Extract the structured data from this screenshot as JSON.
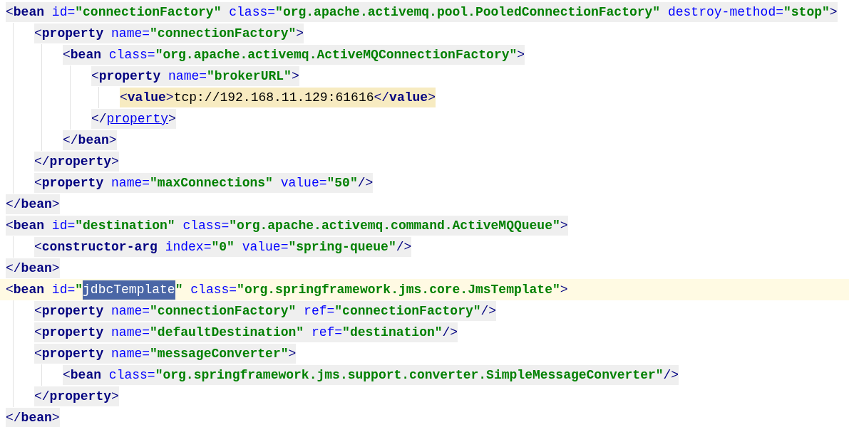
{
  "lines": [
    {
      "shaded": true,
      "matched": false,
      "current": false,
      "tokens": [
        {
          "kind": "open",
          "text": "<"
        },
        {
          "kind": "tag",
          "text": "bean"
        },
        {
          "kind": "attr",
          "text": "id="
        },
        {
          "kind": "value",
          "text": "\"connectionFactory\""
        },
        {
          "kind": "attr",
          "text": "class="
        },
        {
          "kind": "value",
          "text": "\"org.apache.activemq.pool.PooledConnectionFactory\""
        },
        {
          "kind": "attr",
          "text": "destroy-method="
        },
        {
          "kind": "value",
          "text": "\"stop\""
        },
        {
          "kind": "close",
          "text": ">"
        }
      ],
      "children": [
        {
          "shaded": true,
          "matched": false,
          "current": false,
          "tokens": [
            {
              "kind": "open",
              "text": "<"
            },
            {
              "kind": "tag",
              "text": "property"
            },
            {
              "kind": "attr",
              "text": "name="
            },
            {
              "kind": "value",
              "text": "\"connectionFactory\""
            },
            {
              "kind": "close",
              "text": ">"
            }
          ],
          "children": [
            {
              "shaded": true,
              "matched": false,
              "current": false,
              "tokens": [
                {
                  "kind": "open",
                  "text": "<"
                },
                {
                  "kind": "tag",
                  "text": "bean"
                },
                {
                  "kind": "attr",
                  "text": "class="
                },
                {
                  "kind": "value",
                  "text": "\"org.apache.activemq.ActiveMQConnectionFactory\""
                },
                {
                  "kind": "close",
                  "text": ">"
                }
              ],
              "children": [
                {
                  "shaded": true,
                  "matched": false,
                  "current": false,
                  "tokens": [
                    {
                      "kind": "open",
                      "text": "<"
                    },
                    {
                      "kind": "tag",
                      "text": "property"
                    },
                    {
                      "kind": "attr",
                      "text": "name="
                    },
                    {
                      "kind": "value",
                      "text": "\"brokerURL\""
                    },
                    {
                      "kind": "close",
                      "text": ">"
                    }
                  ],
                  "children": [
                    {
                      "matched": true,
                      "current": false,
                      "tokens": [
                        {
                          "kind": "open",
                          "text": "<"
                        },
                        {
                          "kind": "tag",
                          "text": "value"
                        },
                        {
                          "kind": "close",
                          "text": ">"
                        },
                        {
                          "kind": "text",
                          "text": "tcp://192.168.11.129:61616"
                        },
                        {
                          "kind": "open",
                          "text": "</"
                        },
                        {
                          "kind": "tag",
                          "text": "value"
                        },
                        {
                          "kind": "close",
                          "text": ">"
                        }
                      ]
                    }
                  ]
                },
                {
                  "shaded": true,
                  "matched": false,
                  "current": false,
                  "tokens": [
                    {
                      "kind": "open",
                      "text": "</"
                    },
                    {
                      "kind": "tag",
                      "text": "property",
                      "underlined": true
                    },
                    {
                      "kind": "close",
                      "text": ">"
                    }
                  ]
                }
              ]
            },
            {
              "shaded": true,
              "matched": false,
              "current": false,
              "tokens": [
                {
                  "kind": "open",
                  "text": "</"
                },
                {
                  "kind": "tag",
                  "text": "bean"
                },
                {
                  "kind": "close",
                  "text": ">"
                }
              ]
            }
          ]
        },
        {
          "shaded": true,
          "matched": false,
          "current": false,
          "tokens": [
            {
              "kind": "open",
              "text": "</"
            },
            {
              "kind": "tag",
              "text": "property"
            },
            {
              "kind": "close",
              "text": ">"
            }
          ]
        },
        {
          "shaded": true,
          "matched": false,
          "current": false,
          "tokens": [
            {
              "kind": "open",
              "text": "<"
            },
            {
              "kind": "tag",
              "text": "property"
            },
            {
              "kind": "attr",
              "text": "name="
            },
            {
              "kind": "value",
              "text": "\"maxConnections\""
            },
            {
              "kind": "attr",
              "text": "value="
            },
            {
              "kind": "value",
              "text": "\"50\""
            },
            {
              "kind": "close",
              "text": "/>"
            }
          ]
        }
      ]
    },
    {
      "shaded": true,
      "matched": false,
      "current": false,
      "tokens": [
        {
          "kind": "open",
          "text": "</"
        },
        {
          "kind": "tag",
          "text": "bean"
        },
        {
          "kind": "close",
          "text": ">"
        }
      ]
    },
    {
      "shaded": true,
      "matched": false,
      "current": false,
      "tokens": [
        {
          "kind": "open",
          "text": "<"
        },
        {
          "kind": "tag",
          "text": "bean"
        },
        {
          "kind": "attr",
          "text": "id="
        },
        {
          "kind": "value",
          "text": "\"destination\""
        },
        {
          "kind": "attr",
          "text": "class="
        },
        {
          "kind": "value",
          "text": "\"org.apache.activemq.command.ActiveMQQueue\""
        },
        {
          "kind": "close",
          "text": ">"
        }
      ],
      "children": [
        {
          "shaded": true,
          "matched": false,
          "current": false,
          "tokens": [
            {
              "kind": "open",
              "text": "<"
            },
            {
              "kind": "tag",
              "text": "constructor-arg"
            },
            {
              "kind": "attr",
              "text": "index="
            },
            {
              "kind": "value",
              "text": "\"0\""
            },
            {
              "kind": "attr",
              "text": "value="
            },
            {
              "kind": "value",
              "text": "\"spring-queue\""
            },
            {
              "kind": "close",
              "text": "/>"
            }
          ]
        }
      ]
    },
    {
      "shaded": true,
      "matched": false,
      "current": false,
      "tokens": [
        {
          "kind": "open",
          "text": "</"
        },
        {
          "kind": "tag",
          "text": "bean"
        },
        {
          "kind": "close",
          "text": ">"
        }
      ]
    },
    {
      "shaded": false,
      "matched": false,
      "current": true,
      "tokens": [
        {
          "kind": "open",
          "text": "<"
        },
        {
          "kind": "tag",
          "text": "bean"
        },
        {
          "kind": "attr",
          "text": "id="
        },
        {
          "kind": "value",
          "text": "\""
        },
        {
          "kind": "value",
          "text": "jdbcTemplate",
          "selected": true
        },
        {
          "kind": "value",
          "text": "\""
        },
        {
          "kind": "attr",
          "text": "class="
        },
        {
          "kind": "value",
          "text": "\"org.springframework.jms.core.JmsTemplate\""
        },
        {
          "kind": "close",
          "text": ">"
        }
      ],
      "children": [
        {
          "shaded": true,
          "matched": false,
          "current": false,
          "tokens": [
            {
              "kind": "open",
              "text": "<"
            },
            {
              "kind": "tag",
              "text": "property"
            },
            {
              "kind": "attr",
              "text": "name="
            },
            {
              "kind": "value",
              "text": "\"connectionFactory\""
            },
            {
              "kind": "attr",
              "text": "ref="
            },
            {
              "kind": "value",
              "text": "\"connectionFactory\""
            },
            {
              "kind": "close",
              "text": "/>"
            }
          ]
        },
        {
          "shaded": true,
          "matched": false,
          "current": false,
          "tokens": [
            {
              "kind": "open",
              "text": "<"
            },
            {
              "kind": "tag",
              "text": "property"
            },
            {
              "kind": "attr",
              "text": "name="
            },
            {
              "kind": "value",
              "text": "\"defaultDestination\""
            },
            {
              "kind": "attr",
              "text": "ref="
            },
            {
              "kind": "value",
              "text": "\"destination\""
            },
            {
              "kind": "close",
              "text": "/>"
            }
          ]
        },
        {
          "shaded": true,
          "matched": false,
          "current": false,
          "tokens": [
            {
              "kind": "open",
              "text": "<"
            },
            {
              "kind": "tag",
              "text": "property"
            },
            {
              "kind": "attr",
              "text": "name="
            },
            {
              "kind": "value",
              "text": "\"messageConverter\""
            },
            {
              "kind": "close",
              "text": ">"
            }
          ],
          "children": [
            {
              "shaded": true,
              "matched": false,
              "current": false,
              "tokens": [
                {
                  "kind": "open",
                  "text": "<"
                },
                {
                  "kind": "tag",
                  "text": "bean"
                },
                {
                  "kind": "attr",
                  "text": "class="
                },
                {
                  "kind": "value",
                  "text": "\"org.springframework.jms.support.converter.SimpleMessageConverter\""
                },
                {
                  "kind": "close",
                  "text": "/>"
                }
              ]
            }
          ]
        },
        {
          "shaded": true,
          "matched": false,
          "current": false,
          "tokens": [
            {
              "kind": "open",
              "text": "</"
            },
            {
              "kind": "tag",
              "text": "property"
            },
            {
              "kind": "close",
              "text": ">"
            }
          ]
        }
      ]
    },
    {
      "shaded": true,
      "matched": false,
      "current": false,
      "tokens": [
        {
          "kind": "open",
          "text": "</"
        },
        {
          "kind": "tag",
          "text": "bean"
        },
        {
          "kind": "close",
          "text": ">"
        }
      ]
    }
  ]
}
